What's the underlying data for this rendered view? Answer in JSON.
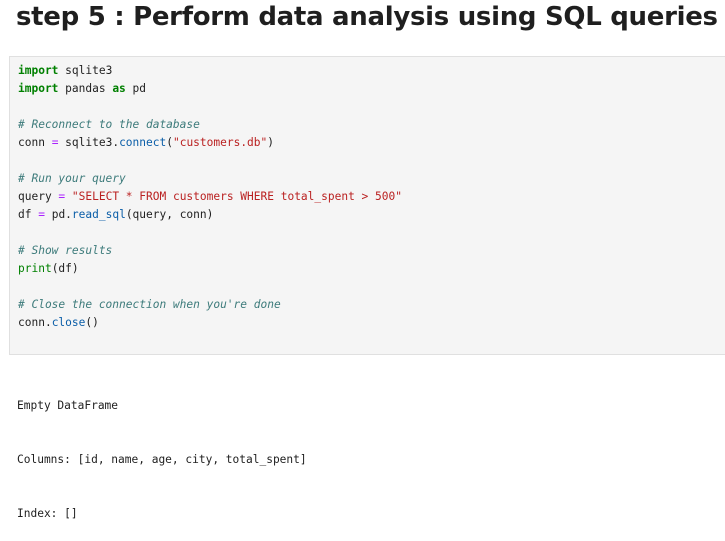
{
  "title": "step 5 : Perform data analysis using SQL queries",
  "code_lines": [
    [
      {
        "t": "import",
        "c": "kw"
      },
      {
        "t": " sqlite3"
      }
    ],
    [
      {
        "t": "import",
        "c": "kw"
      },
      {
        "t": " pandas "
      },
      {
        "t": "as",
        "c": "kw"
      },
      {
        "t": " pd"
      }
    ],
    [],
    [
      {
        "t": "# Reconnect to the database",
        "c": "cm"
      }
    ],
    [
      {
        "t": "conn "
      },
      {
        "t": "=",
        "c": "op"
      },
      {
        "t": " sqlite3."
      },
      {
        "t": "connect",
        "c": "fn"
      },
      {
        "t": "("
      },
      {
        "t": "\"customers.db\"",
        "c": "st"
      },
      {
        "t": ")"
      }
    ],
    [],
    [
      {
        "t": "# Run your query",
        "c": "cm"
      }
    ],
    [
      {
        "t": "query "
      },
      {
        "t": "=",
        "c": "op"
      },
      {
        "t": " "
      },
      {
        "t": "\"SELECT * FROM customers WHERE total_spent > 500\"",
        "c": "st"
      }
    ],
    [
      {
        "t": "df "
      },
      {
        "t": "=",
        "c": "op"
      },
      {
        "t": " pd."
      },
      {
        "t": "read_sql",
        "c": "fn"
      },
      {
        "t": "(query, conn)"
      }
    ],
    [],
    [
      {
        "t": "# Show results",
        "c": "cm"
      }
    ],
    [
      {
        "t": "print",
        "c": "bi"
      },
      {
        "t": "(df)"
      }
    ],
    [],
    [
      {
        "t": "# Close the connection when you're done",
        "c": "cm"
      }
    ],
    [
      {
        "t": "conn."
      },
      {
        "t": "close",
        "c": "fn"
      },
      {
        "t": "()"
      }
    ]
  ],
  "output_lines": [
    "Empty DataFrame",
    "Columns: [id, name, age, city, total_spent]",
    "Index: []"
  ]
}
